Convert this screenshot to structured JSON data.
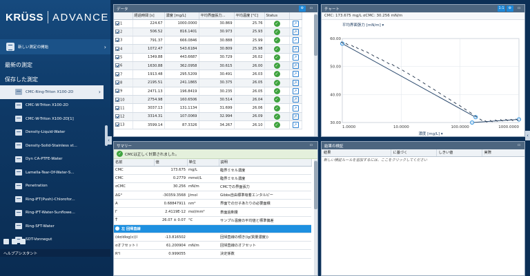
{
  "brand": {
    "name": "KRÜSS",
    "product": "ADVANCE"
  },
  "sidebar": {
    "new_measurement": "新しい測定の開始",
    "recent": "最新の測定",
    "saved": "保存した測定",
    "help": "ヘルプアシスタント",
    "items": [
      "CMC-Ring-Triton X100-2D",
      "CMC-W-Triton X100-2D",
      "CMC-W-Triton X100-2D[1]",
      "Density-Liquid-Water",
      "Density-Solid-Stainless st...",
      "Dyn CA-PTFE-Water",
      "Lamella-Tear-Of-Water-S...",
      "Penetration",
      "Ring-IFT(Push)-Chlorofor...",
      "Ring-IFT-Water-Sunflowe...",
      "Ring-SFT-Water",
      "SDT-Vonnegut"
    ],
    "selected_index": 0
  },
  "data_panel": {
    "title": "データ",
    "columns": [
      "",
      "経過時間 [s]",
      "濃度 [mg/L]",
      "平均界面張力...",
      "平均温度 [°C]",
      "Status",
      ""
    ],
    "rows": [
      [
        "1",
        "224.67",
        "1000.0000",
        "30.869",
        "25.76"
      ],
      [
        "2",
        "506.52",
        "816.1401",
        "30.973",
        "25.93"
      ],
      [
        "3",
        "791.37",
        "666.0846",
        "30.888",
        "25.99"
      ],
      [
        "4",
        "1072.47",
        "543.6184",
        "30.809",
        "25.98"
      ],
      [
        "5",
        "1349.88",
        "443.6687",
        "30.729",
        "26.02"
      ],
      [
        "6",
        "1630.88",
        "362.0958",
        "30.615",
        "26.00"
      ],
      [
        "7",
        "1913.48",
        "295.5209",
        "30.491",
        "26.03"
      ],
      [
        "8",
        "2195.51",
        "241.1865",
        "30.375",
        "26.05"
      ],
      [
        "9",
        "2471.13",
        "196.8419",
        "30.235",
        "26.05"
      ],
      [
        "10",
        "2754.98",
        "160.6506",
        "30.514",
        "26.04"
      ],
      [
        "11",
        "3037.13",
        "131.1134",
        "31.699",
        "26.06"
      ],
      [
        "12",
        "3314.31",
        "107.0069",
        "32.994",
        "26.09"
      ],
      [
        "13",
        "3599.14",
        "87.3326",
        "34.267",
        "26.10"
      ]
    ]
  },
  "chart_panel": {
    "title": "チャート",
    "zoom": "1:1",
    "cmc_line": "CMC: 173.675 mg/L   σCMC: 30.256 mN/m",
    "y_selector": "平均界面張力 [mN/m]",
    "chart_data": {
      "type": "scatter",
      "x_scale": "log",
      "xlabel": "濃度 [mg/L]",
      "ylabel": "平均界面張力 [mN/m]",
      "xlim": [
        1,
        1000
      ],
      "ylim": [
        30,
        60
      ],
      "x_ticks": [
        "1.0000",
        "10.0000",
        "100.0000",
        "1000.0000"
      ],
      "y_ticks": [
        "30.00",
        "40.00",
        "50.00",
        "60.00"
      ],
      "series": [
        {
          "x": [
            1.0,
            1.2,
            1.5,
            1.8,
            2.2,
            2.7,
            3.3,
            4.0,
            4.9,
            6.0,
            7.3,
            8.9,
            10.9,
            13.4,
            16.4,
            20.0,
            24.5,
            30.0,
            36.7,
            44.9,
            54.9,
            67.2,
            82.3,
            100.6,
            123.0,
            150.6,
            184.3,
            225.6,
            276.0,
            337.8,
            413.4,
            505.9,
            619.2,
            757.8,
            927.4
          ],
          "y": [
            58.5,
            58.0,
            57.3,
            56.6,
            55.8,
            55.0,
            54.0,
            53.1,
            52.2,
            51.2,
            50.5,
            49.5,
            48.5,
            47.4,
            46.3,
            45.2,
            44.0,
            42.8,
            41.7,
            40.5,
            39.3,
            38.2,
            37.0,
            35.9,
            34.7,
            33.5,
            32.2,
            31.0,
            30.4,
            30.5,
            30.7,
            30.8,
            30.9,
            30.9,
            31.0
          ]
        }
      ],
      "fit_lines": [
        {
          "x": [
            1,
            184
          ],
          "y": [
            58.2,
            31.9
          ]
        },
        {
          "x": [
            160,
            1000
          ],
          "y": [
            30.0,
            31.1
          ]
        }
      ]
    }
  },
  "summary_panel": {
    "title": "サマリー",
    "success": "CMCは正しく計算されました。",
    "columns": [
      "名前",
      "値",
      "単位",
      "説明"
    ],
    "rows": [
      [
        "CMC",
        "173.675",
        "mg/L",
        "臨界ミセル濃度"
      ],
      [
        "CMC",
        "0.2779",
        "mmol/L",
        "臨界ミセル濃度"
      ],
      [
        "σCMC",
        "30.256",
        "mN/m",
        "CMCでの界面張力"
      ],
      [
        "ΔG°",
        "-30359.3568",
        "J/mol",
        "Gibbs自由標準吸着エンタルピー"
      ],
      [
        "A",
        "0.68847911",
        "nm²",
        "界面での分子あたりの必要面積"
      ],
      [
        "Γ",
        "2.4119E-12",
        "mol/mm²",
        "表面過剰量"
      ],
      [
        "T̄",
        "26.07 ± 0.07",
        "°C",
        "サンプル温度の平均値と標準偏差"
      ]
    ],
    "section": "左 回帰直線",
    "rows2": [
      [
        "(dσ/dlog(c))l",
        "-13.816502",
        "",
        "回帰直線の傾き(lg(質量濃度))"
      ],
      [
        "σオフセット l",
        "61.200904",
        "mN/m",
        "回帰直線のオフセット"
      ],
      [
        "R²l",
        "0.999055",
        "",
        "決定係数"
      ]
    ]
  },
  "validation_panel": {
    "title": "結果の検証",
    "columns": [
      "結果",
      "に基づく",
      "しきい値",
      "実際"
    ],
    "hint": "新しい検証ルールを追加するには、ここをクリックしてください"
  },
  "colors": {
    "sidebar": "#0e3966",
    "accent": "#1e88d8",
    "ok": "#3fa33f",
    "title_bar": "#4d6680"
  }
}
